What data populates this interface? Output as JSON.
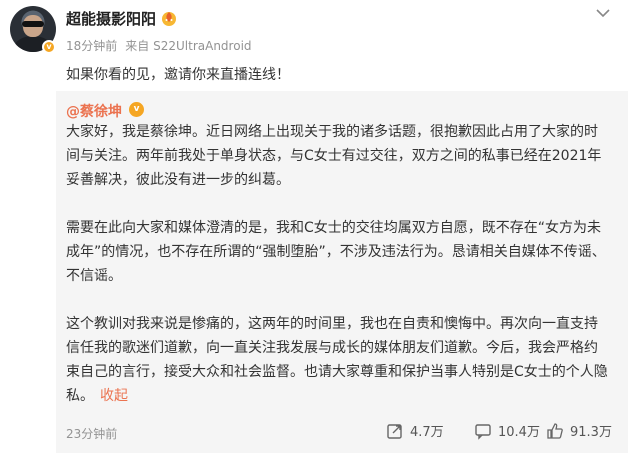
{
  "post": {
    "username": "超能摄影阳阳",
    "time": "18分钟前",
    "source_prefix": "来自",
    "source": "S22UltraAndroid",
    "text": "如果你看的见，邀请你来直播连线！"
  },
  "repost": {
    "author": "@蔡徐坤",
    "paragraphs": [
      [
        "大家好，我是蔡徐坤。近日网络上出现关于我的诸多话题，很抱歉因此占用了大家的时",
        "间与关注。两年前我处于单身状态，与C女士有过交往，双方之间的私事已经在2021年",
        "妥善解决，彼此没有进一步的纠葛。"
      ],
      [
        "需要在此向大家和媒体澄清的是，我和C女士的交往均属双方自愿，既不存在“女方为未",
        "成年”的情况，也不存在所谓的“强制堕胎”，不涉及违法行为。恳请相关自媒体不传谣、",
        "不信谣。"
      ],
      [
        "这个教训对我来说是惨痛的，这两年的时间里，我也在自责和懊悔中。再次向一直支持",
        "信任我的歌迷们道歉，向一直关注我发展与成长的媒体朋友们道歉。今后，我会严格约",
        "束自己的言行，接受大众和社会监督。也请大家尊重和保护当事人特别是C女士的个人隐",
        "私。"
      ]
    ],
    "collapse_label": "收起",
    "time": "23分钟前",
    "reposts": "4.7万",
    "comments": "10.4万",
    "likes": "91.3万"
  },
  "icons": [
    "avatar",
    "verified-badge",
    "fire-medal-icon",
    "chevron-down-icon",
    "repost-icon",
    "comment-icon",
    "like-icon"
  ],
  "colors": {
    "accent": "#eb7350",
    "muted": "#939393",
    "repost_bg": "#f5f5f5",
    "badge": "#f5a623"
  }
}
